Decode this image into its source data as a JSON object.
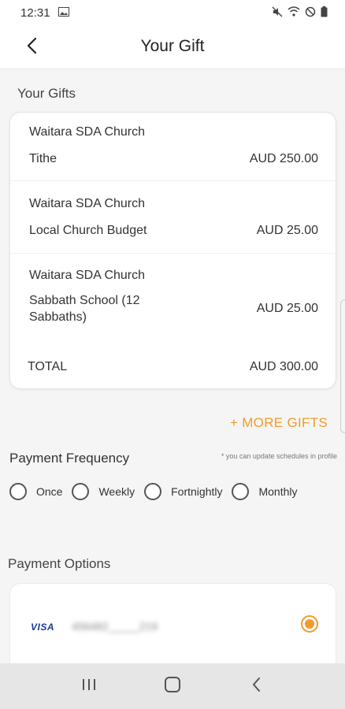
{
  "status_bar": {
    "time": "12:31"
  },
  "header": {
    "title": "Your Gift"
  },
  "gifts": {
    "section_label": "Your Gifts",
    "items": [
      {
        "church": "Waitara SDA Church",
        "fund": "Tithe",
        "amount": "AUD 250.00"
      },
      {
        "church": "Waitara SDA Church",
        "fund": "Local Church Budget",
        "amount": "AUD 25.00"
      },
      {
        "church": "Waitara SDA Church",
        "fund": "Sabbath School (12 Sabbaths)",
        "amount": "AUD 25.00"
      }
    ],
    "total_label": "TOTAL",
    "total_amount": "AUD 300.00",
    "more_gifts_label": "+ MORE GIFTS"
  },
  "frequency": {
    "label": "Payment Frequency",
    "note": "* you can update schedules in profile",
    "options": [
      "Once",
      "Weekly",
      "Fortnightly",
      "Monthly"
    ],
    "selected": null
  },
  "payment": {
    "label": "Payment Options",
    "card_brand": "VISA",
    "card_number_masked": "456482_____219",
    "selected": true
  },
  "colors": {
    "accent": "#f39a2b",
    "visa_blue": "#1a3a8f",
    "background": "#f5f5f5"
  }
}
